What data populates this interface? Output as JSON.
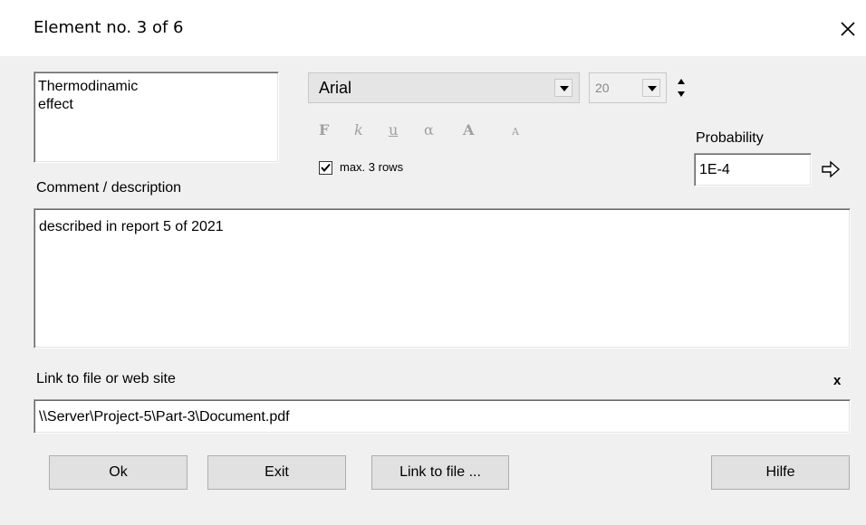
{
  "window": {
    "title": "Element no. 3 of 6"
  },
  "element_name": {
    "lines": [
      "Thermodinamic",
      "effect"
    ]
  },
  "font": {
    "family": "Arial",
    "size": "20"
  },
  "format_buttons": [
    "F",
    "k",
    "u",
    "α",
    "A",
    "A"
  ],
  "max_rows": {
    "label": "max. 3 rows",
    "checked": true
  },
  "probability": {
    "label": "Probability",
    "value": "1E-4"
  },
  "comment": {
    "label": "Comment / description",
    "value": "described in report 5 of 2021"
  },
  "link": {
    "label": "Link to file or web site",
    "clear_label": "x",
    "value": "\\\\Server\\Project-5\\Part-3\\Document.pdf"
  },
  "buttons": {
    "ok": "Ok",
    "exit": "Exit",
    "link_to_file": "Link to file ...",
    "help": "Hilfe"
  }
}
